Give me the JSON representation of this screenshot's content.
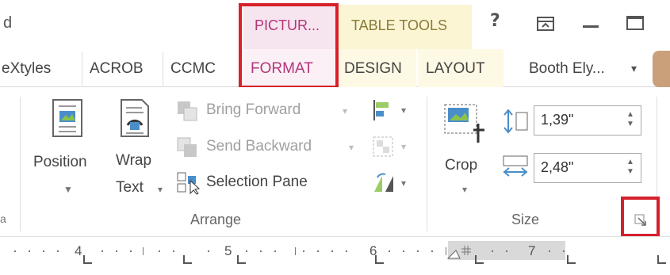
{
  "titlebar": {
    "partial_left": "d",
    "context_picture_label": "PICTUR...",
    "context_table_label": "TABLE TOOLS",
    "help": "?",
    "colors": {
      "picture_accent": "#b3367a",
      "table_bg": "#fbf5d3",
      "highlight": "#d6202a"
    }
  },
  "tabs": {
    "t1": "eXtyles",
    "t2": "ACROB",
    "t3": "CCMC",
    "t4": "FORMAT",
    "t5": "DESIGN",
    "t6": "LAYOUT",
    "user": "Booth Ely...",
    "user_caret": "▾"
  },
  "ribbon": {
    "arrange": {
      "position_label": "Position",
      "wrap_label_1": "Wrap",
      "wrap_label_2": "Text",
      "bring_forward": "Bring Forward",
      "send_backward": "Send Backward",
      "selection_pane": "Selection Pane",
      "group_label": "Arrange"
    },
    "size": {
      "crop_label": "Crop",
      "height_value": "1,39\"",
      "width_value": "2,48\"",
      "group_label": "Size"
    },
    "partial_left_group_marker": "a"
  },
  "ruler": {
    "n4": "4",
    "n5": "5",
    "n6": "6",
    "n7": "7"
  }
}
